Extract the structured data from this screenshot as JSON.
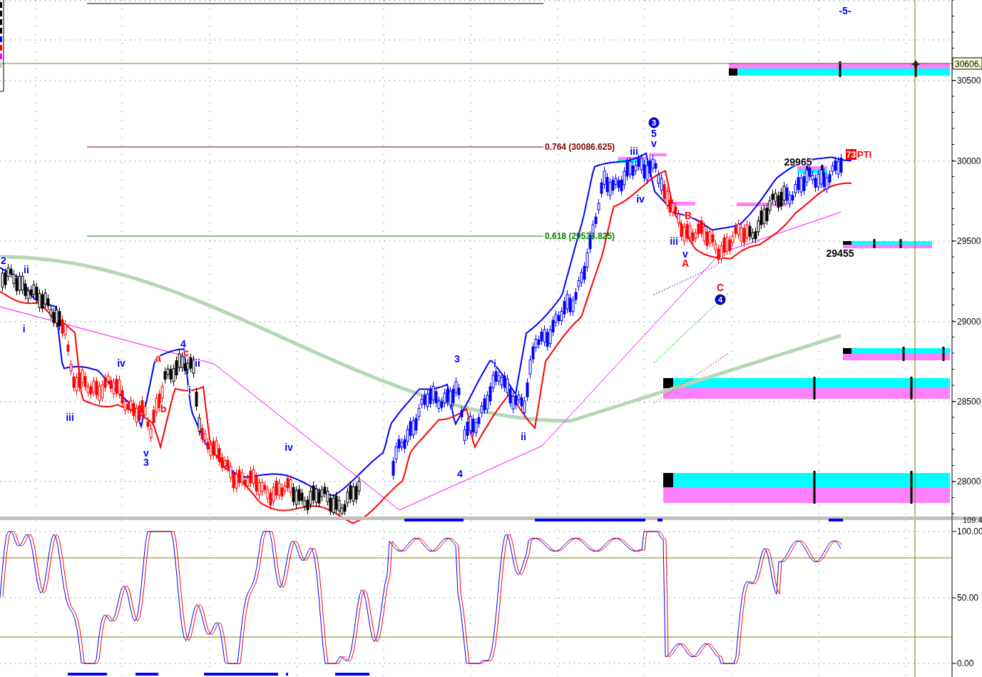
{
  "price_panel": {
    "axis_ticks": [
      "30500",
      "30000",
      "29500",
      "29000",
      "28500",
      "28000"
    ],
    "price_tag": "30606.",
    "fib_levels": [
      {
        "label": "0.764 (30086.625)",
        "color": "#800000"
      },
      {
        "label": "0.618 (29533.825)",
        "color": "#008000"
      }
    ],
    "wave_labels": [
      {
        "text": "-5-",
        "color": "#0000ff"
      },
      {
        "text": "3",
        "color": "#0000ff",
        "kind": "circled"
      },
      {
        "text": "5",
        "color": "#0000ff"
      },
      {
        "text": "v",
        "color": "#0000ff"
      },
      {
        "text": "iii",
        "color": "#0000ff"
      },
      {
        "text": "iv",
        "color": "#0000ff"
      },
      {
        "text": "B",
        "color": "#ff0000"
      },
      {
        "text": "iii",
        "color": "#0000ff"
      },
      {
        "text": "v",
        "color": "#0000ff"
      },
      {
        "text": "A",
        "color": "#ff0000"
      },
      {
        "text": "C",
        "color": "#ff0000"
      },
      {
        "text": "4",
        "color": "#0000ff",
        "kind": "circled"
      },
      {
        "text": "29965",
        "color": "#000000"
      },
      {
        "text": "29455",
        "color": "#000000"
      },
      {
        "text": "2",
        "color": "#0000ff"
      },
      {
        "text": "ii",
        "color": "#0000ff"
      },
      {
        "text": "i",
        "color": "#0000ff"
      },
      {
        "text": "iii",
        "color": "#0000ff"
      },
      {
        "text": "iv",
        "color": "#0000ff"
      },
      {
        "text": "a",
        "color": "#ff0000"
      },
      {
        "text": "b",
        "color": "#ff0000"
      },
      {
        "text": "4",
        "color": "#0000ff"
      },
      {
        "text": "c",
        "color": "#ff0000"
      },
      {
        "text": "ii",
        "color": "#0000ff"
      },
      {
        "text": "i",
        "color": "#0000ff"
      },
      {
        "text": "v",
        "color": "#0000ff"
      },
      {
        "text": "3",
        "color": "#0000ff"
      },
      {
        "text": "iv",
        "color": "#0000ff"
      },
      {
        "text": "3",
        "color": "#0000ff"
      },
      {
        "text": "i",
        "color": "#0000ff"
      },
      {
        "text": "4",
        "color": "#0000ff"
      },
      {
        "text": "ii",
        "color": "#0000ff"
      }
    ],
    "signal_badge": {
      "count": "73",
      "text": "PTI"
    }
  },
  "oscillator_panel": {
    "top_value": "109.4",
    "axis_ticks": [
      "100.00",
      "50.00",
      "0.00"
    ]
  }
}
